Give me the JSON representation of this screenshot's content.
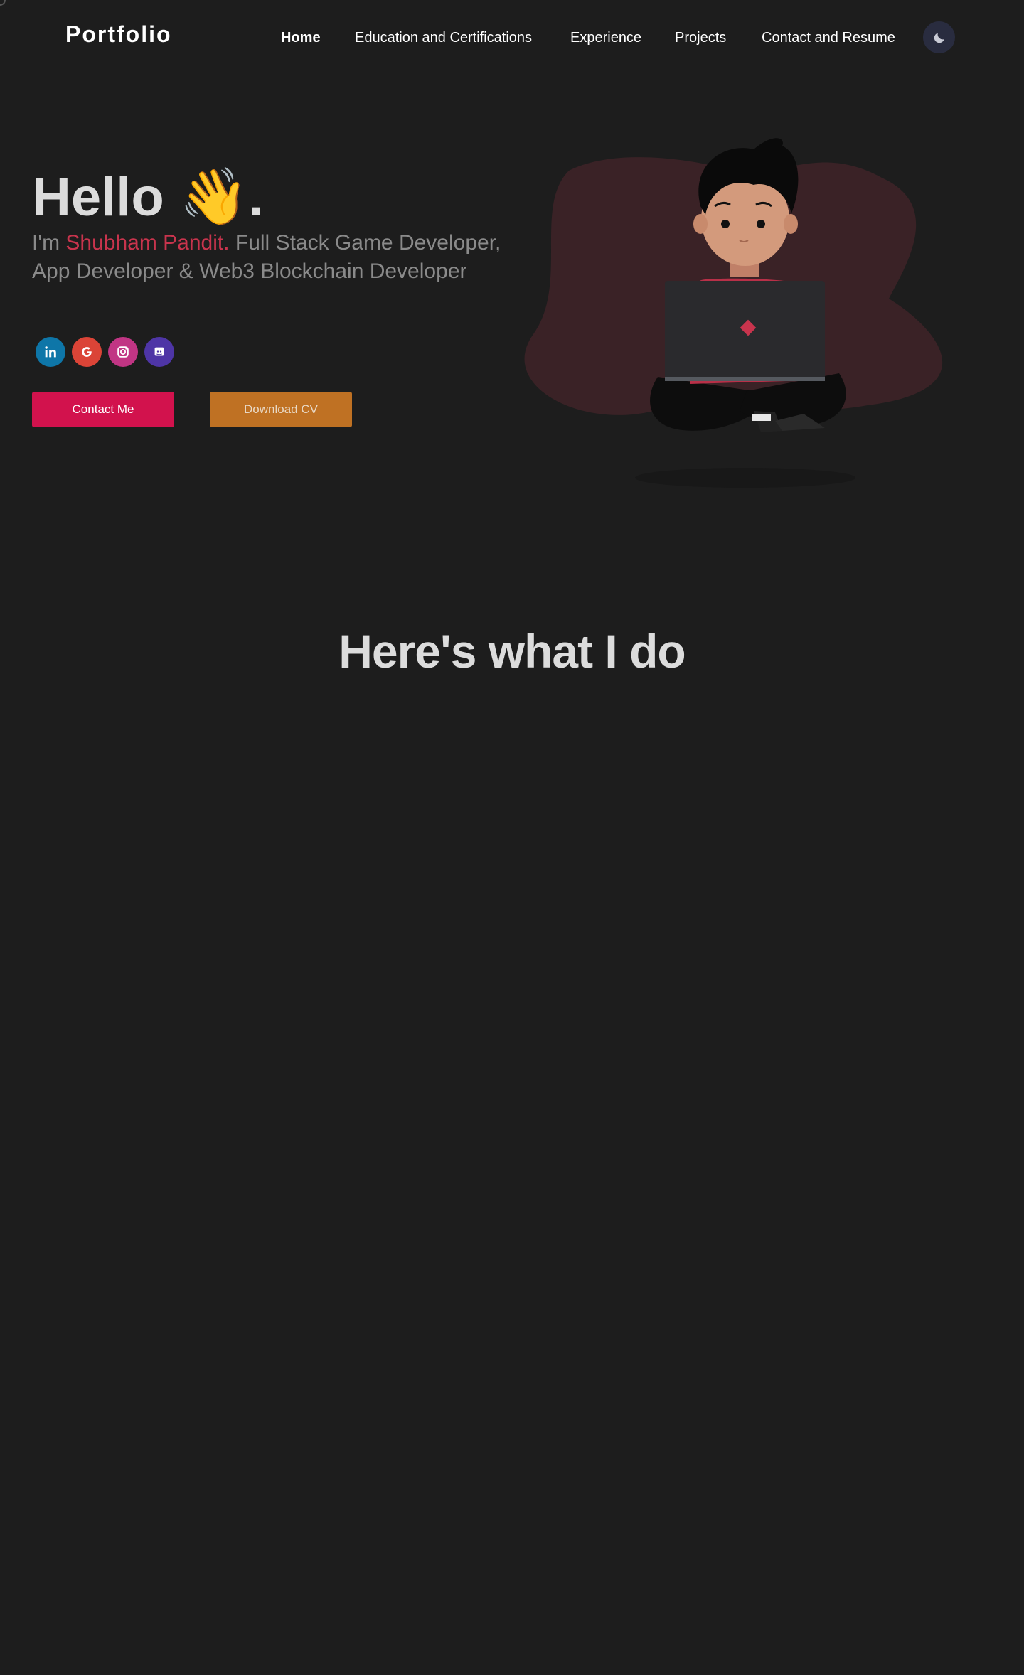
{
  "header": {
    "logo": "Portfolio",
    "nav": [
      {
        "label": "Home",
        "active": true
      },
      {
        "label": "Education and Certifications",
        "active": false
      },
      {
        "label": "Experience",
        "active": false
      },
      {
        "label": "Projects",
        "active": false
      },
      {
        "label": "Contact and Resume",
        "active": false
      }
    ],
    "theme_toggle_icon": "moon-icon"
  },
  "hero": {
    "greeting": "Hello",
    "wave_emoji": "👋",
    "period": ".",
    "intro_prefix": "I'm ",
    "name": "Shubham Pandit.",
    "intro_rest": " Full Stack Game Developer, App Developer & Web3 Blockchain Developer",
    "socials": [
      {
        "icon": "linkedin-icon",
        "color": "#0e76a8"
      },
      {
        "icon": "google-icon",
        "color": "#db4437"
      },
      {
        "icon": "instagram-icon",
        "color": "#c13584"
      },
      {
        "icon": "discord-icon",
        "color": "#4e35a6"
      }
    ],
    "contact_button": "Contact Me",
    "cv_button": "Download CV"
  },
  "section": {
    "title": "Here's what I do"
  },
  "colors": {
    "background": "#1d1d1d",
    "accent_name": "#c8344d",
    "contact_button": "#d2124d",
    "cv_button": "#bf7123"
  }
}
